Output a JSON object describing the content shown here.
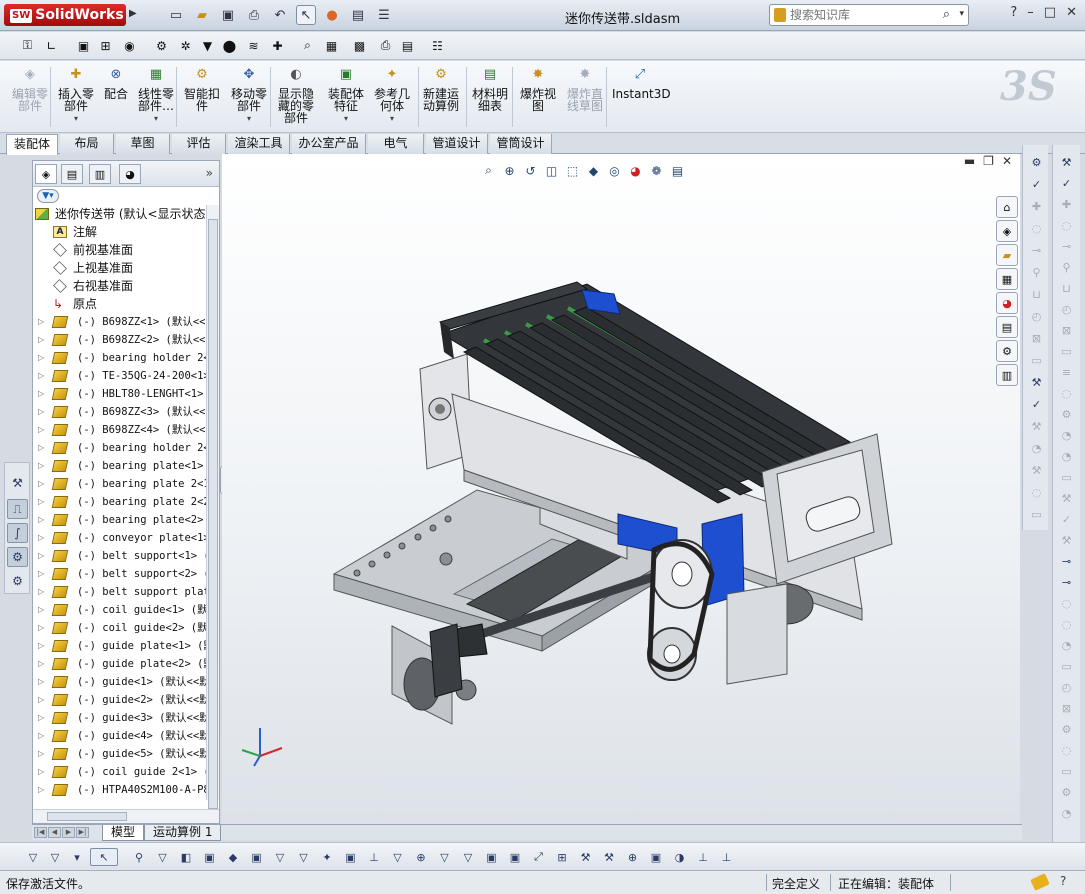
{
  "app": {
    "logo_text": "SolidWorks",
    "logo_badge": "SW",
    "document_title": "迷你传送带.sldasm",
    "search_placeholder": "搜索知识库",
    "window_buttons": [
      "?",
      "–",
      "□",
      "✕"
    ],
    "quick_access_icons": [
      "new-document-icon",
      "open-icon",
      "save-icon",
      "print-icon",
      "undo-icon",
      "select-icon",
      "rebuild-icon",
      "file-properties-icon",
      "options-icon"
    ]
  },
  "command_manager": {
    "items": [
      {
        "label": "编辑零\n部件",
        "icon": "edit-component-icon",
        "enabled": false,
        "caret": false
      },
      {
        "label": "插入零\n部件",
        "icon": "insert-component-icon",
        "enabled": true,
        "caret": true
      },
      {
        "label": "配合",
        "icon": "mate-icon",
        "enabled": true,
        "caret": false
      },
      {
        "label": "线性零\n部件…",
        "icon": "linear-pattern-icon",
        "enabled": true,
        "caret": true
      },
      {
        "label": "智能扣\n件",
        "icon": "smart-fasteners-icon",
        "enabled": true,
        "caret": false
      },
      {
        "label": "移动零\n部件",
        "icon": "move-component-icon",
        "enabled": true,
        "caret": true
      },
      {
        "label": "显示隐\n藏的零\n部件",
        "icon": "show-hidden-icon",
        "enabled": true,
        "caret": false
      },
      {
        "label": "装配体\n特征",
        "icon": "assembly-features-icon",
        "enabled": true,
        "caret": true
      },
      {
        "label": "参考几\n何体",
        "icon": "reference-geometry-icon",
        "enabled": true,
        "caret": true
      },
      {
        "label": "新建运\n动算例",
        "icon": "new-motion-study-icon",
        "enabled": true,
        "caret": false
      },
      {
        "label": "材料明\n细表",
        "icon": "bom-icon",
        "enabled": true,
        "caret": false
      },
      {
        "label": "爆炸视\n图",
        "icon": "exploded-view-icon",
        "enabled": true,
        "caret": false
      },
      {
        "label": "爆炸直\n线草图",
        "icon": "explode-line-sketch-icon",
        "enabled": false,
        "caret": false
      },
      {
        "label": "Instant3D",
        "icon": "instant3d-icon",
        "enabled": true,
        "caret": false
      }
    ]
  },
  "tabs": [
    "装配体",
    "布局",
    "草图",
    "评估",
    "渲染工具",
    "办公室产品",
    "电气",
    "管道设计",
    "管筒设计"
  ],
  "feature_tree": {
    "root": "迷你传送带  (默认<显示状态",
    "features": [
      {
        "label": "注解",
        "icon": "annotations-icon"
      },
      {
        "label": "前视基准面",
        "icon": "plane-icon"
      },
      {
        "label": "上视基准面",
        "icon": "plane-icon"
      },
      {
        "label": "右视基准面",
        "icon": "plane-icon"
      },
      {
        "label": "原点",
        "icon": "origin-icon"
      }
    ],
    "components": [
      "(-) B698ZZ<1> (默认<<默",
      "(-) B698ZZ<2> (默认<<默",
      "(-) bearing holder 2<1>",
      "(-) TE-35QG-24-200<1> (",
      "(-) HBLT80-LENGHT<1> (",
      "(-) B698ZZ<3> (默认<<默",
      "(-) B698ZZ<4> (默认<<默",
      "(-) bearing holder 2<2>",
      "(-) bearing plate<1> (",
      "(-) bearing plate 2<1>",
      "(-) bearing plate 2<2>",
      "(-) bearing plate<2> (",
      "(-) conveyor plate<1>",
      "(-) belt support<1> (默",
      "(-) belt support<2> (默",
      "(-) belt support plate",
      "(-) coil guide<1> (默认",
      "(-) coil guide<2> (默认",
      "(-) guide plate<1> (默",
      "(-) guide plate<2> (默",
      "(-) guide<1> (默认<<默",
      "(-) guide<2> (默认<<默",
      "(-) guide<3> (默认<<默",
      "(-) guide<4> (默认<<默",
      "(-) guide<5> (默认<<默",
      "(-) coil guide 2<1> (",
      "(-) HTPA40S2M100-A-P8<"
    ]
  },
  "bottom_tabs": [
    "模型",
    "运动算例 1"
  ],
  "status": {
    "message": "保存激活文件。",
    "definition": "完全定义",
    "editing": "正在编辑：装配体",
    "help": "?"
  },
  "colors": {
    "belt_dark": "#2b2e31",
    "belt_green": "#3b9a4a",
    "frame_silver": "#cfd3d8",
    "accent_blue": "#1f4fd1",
    "logo_red": "#c0101a"
  }
}
